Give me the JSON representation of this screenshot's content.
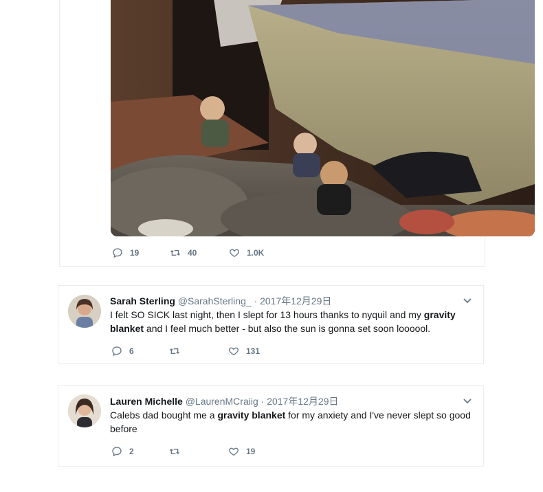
{
  "photo_tweet": {
    "replies": "19",
    "retweets": "40",
    "likes": "1.0K"
  },
  "tweets": [
    {
      "name": "Sarah Sterling",
      "handle": "@SarahSterling_",
      "separator": "·",
      "date": "2017年12月29日",
      "text_parts": [
        "I felt SO SICK last night, then I slept for 13 hours thanks to nyquil and my ",
        "gravity blanket",
        " and I feel much better - but also the sun is gonna set soon loooool."
      ],
      "replies": "6",
      "retweets": "",
      "likes": "131"
    },
    {
      "name": "Lauren Michelle",
      "handle": "@LaurenMCraiig",
      "separator": "·",
      "date": "2017年12月29日",
      "text_parts": [
        "Calebs dad bought me a ",
        "gravity blanket",
        " for my anxiety and I've never slept so good before"
      ],
      "replies": "2",
      "retweets": "",
      "likes": "19"
    }
  ],
  "icons": {
    "reply": "reply-icon",
    "retweet": "retweet-icon",
    "like": "heart-icon",
    "menu": "chevron-down-icon"
  },
  "colors": {
    "border": "#e6ecf0",
    "muted": "#657786",
    "text": "#14171a"
  }
}
